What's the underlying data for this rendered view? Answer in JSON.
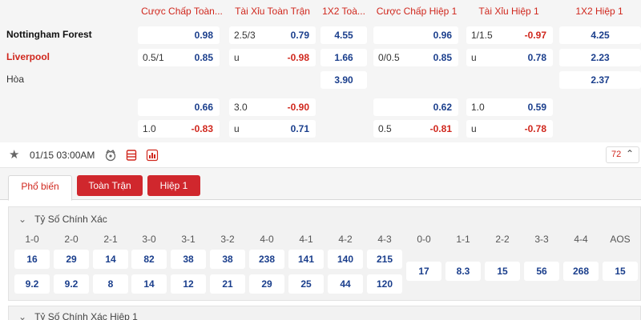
{
  "headers": [
    "Cược Chấp Toàn...",
    "Tài Xỉu Toàn Trận",
    "1X2 Toà...",
    "Cược Chấp Hiệp 1",
    "Tài Xỉu Hiệp 1",
    "1X2 Hiệp 1"
  ],
  "teams": {
    "home": "Nottingham Forest",
    "away": "Liverpool",
    "draw": "Hòa"
  },
  "market1": {
    "hdp_ft": {
      "home_line": "",
      "home_odds": "0.98",
      "away_line": "0.5/1",
      "away_odds": "0.85"
    },
    "ou_ft": {
      "over_line": "2.5/3",
      "over_odds": "0.79",
      "under_label": "u",
      "under_odds": "-0.98"
    },
    "x12_ft": {
      "home": "4.55",
      "away": "1.66",
      "draw": "3.90"
    },
    "hdp_h1": {
      "home_line": "",
      "home_odds": "0.96",
      "away_line": "0/0.5",
      "away_odds": "0.85"
    },
    "ou_h1": {
      "over_line": "1/1.5",
      "over_odds": "-0.97",
      "under_label": "u",
      "under_odds": "0.78"
    },
    "x12_h1": {
      "home": "4.25",
      "away": "2.23",
      "draw": "2.37"
    }
  },
  "market2": {
    "hdp_ft": {
      "home_line": "",
      "home_odds": "0.66",
      "away_line": "1.0",
      "away_odds": "-0.83"
    },
    "ou_ft": {
      "over_line": "3.0",
      "over_odds": "-0.90",
      "under_label": "u",
      "under_odds": "0.71"
    },
    "hdp_h1": {
      "home_line": "",
      "home_odds": "0.62",
      "away_line": "0.5",
      "away_odds": "-0.81"
    },
    "ou_h1": {
      "over_line": "1.0",
      "over_odds": "0.59",
      "under_label": "u",
      "under_odds": "-0.78"
    }
  },
  "toolbar": {
    "datetime": "01/15 03:00AM",
    "more_count": "72",
    "icons": [
      "star-icon",
      "stadium-icon",
      "stats-sheet-icon",
      "bar-chart-icon",
      "chevron-up-icon"
    ]
  },
  "tabs": [
    "Phổ biến",
    "Toàn Trận",
    "Hiệp 1"
  ],
  "correct_score": {
    "title": "Tỷ Số Chính Xác",
    "home_headers": [
      "1-0",
      "2-0",
      "2-1",
      "3-0",
      "3-1",
      "3-2",
      "4-0",
      "4-1",
      "4-2",
      "4-3"
    ],
    "home_row": [
      "16",
      "29",
      "14",
      "82",
      "38",
      "38",
      "238",
      "141",
      "140",
      "215"
    ],
    "away_row": [
      "9.2",
      "9.2",
      "8",
      "14",
      "12",
      "21",
      "29",
      "25",
      "44",
      "120"
    ],
    "draw_headers": [
      "0-0",
      "1-1",
      "2-2",
      "3-3",
      "4-4",
      "AOS"
    ],
    "draw_row": [
      "17",
      "8.3",
      "15",
      "56",
      "268",
      "15"
    ]
  },
  "correct_score_h1": {
    "title": "Tỷ Số Chính Xác Hiệp 1"
  },
  "colors": {
    "accent_red": "#d0271d",
    "odds_blue": "#1a3e8c",
    "panel_gray": "#f5f5f5"
  }
}
